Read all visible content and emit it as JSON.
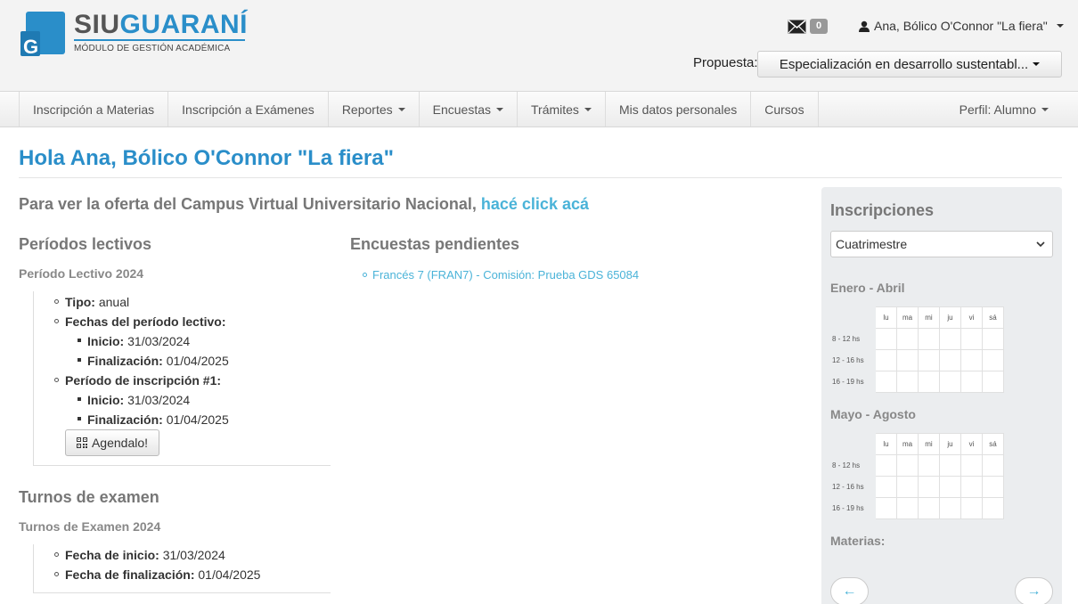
{
  "header": {
    "logo_siu": "SIU",
    "logo_guarani": "GUARANÍ",
    "logo_subtitle": "MÓDULO DE GESTIÓN ACADÉMICA",
    "mail_count": "0",
    "user_name": "Ana, Bólico O'Connor \"La fiera\"",
    "propuesta_label": "Propuesta:",
    "propuesta_value": "Especialización en desarrollo sustentabl..."
  },
  "nav": {
    "items": [
      {
        "label": "Inscripción a Materias"
      },
      {
        "label": "Inscripción a Exámenes"
      },
      {
        "label": "Reportes"
      },
      {
        "label": "Encuestas"
      },
      {
        "label": "Trámites"
      },
      {
        "label": "Mis datos personales"
      },
      {
        "label": "Cursos"
      }
    ],
    "perfil": "Perfil: Alumno"
  },
  "main": {
    "greeting": "Hola Ana, Bólico O'Connor \"La fiera\"",
    "campus_text": "Para ver la oferta del Campus Virtual Universitario Nacional,",
    "campus_link": "hacé click acá",
    "periodos": {
      "title": "Períodos lectivos",
      "subtitle": "Período Lectivo 2024",
      "tipo_label": "Tipo:",
      "tipo_value": "anual",
      "fechas_label": "Fechas del período lectivo:",
      "inicio_label": "Inicio:",
      "inicio_value": "31/03/2024",
      "fin_label": "Finalización:",
      "fin_value": "01/04/2025",
      "inscripcion_label": "Período de inscripción #1:",
      "insc_inicio_label": "Inicio:",
      "insc_inicio_value": "31/03/2024",
      "insc_fin_label": "Finalización:",
      "insc_fin_value": "01/04/2025",
      "agendalo": "Agendalo!"
    },
    "turnos": {
      "title": "Turnos de examen",
      "subtitle": "Turnos de Examen 2024",
      "inicio_label": "Fecha de inicio:",
      "inicio_value": "31/03/2024",
      "fin_label": "Fecha de finalización:",
      "fin_value": "01/04/2025"
    },
    "encuestas": {
      "title": "Encuestas pendientes",
      "item": "Francés 7 (FRAN7) - Comisión: Prueba GDS 65084"
    }
  },
  "panel": {
    "title": "Inscripciones",
    "select_value": "Cuatrimestre",
    "period1": "Enero - Abril",
    "period2": "Mayo - Agosto",
    "days": [
      "lu",
      "ma",
      "mi",
      "ju",
      "vi",
      "sá"
    ],
    "hours": [
      "8 - 12 hs",
      "12 - 16 hs",
      "16 - 19 hs"
    ],
    "materias": "Materias:",
    "prev": "←",
    "next": "→"
  },
  "colors": {
    "brand_blue": "#2a8ec9",
    "link_blue": "#4ab3d8"
  }
}
